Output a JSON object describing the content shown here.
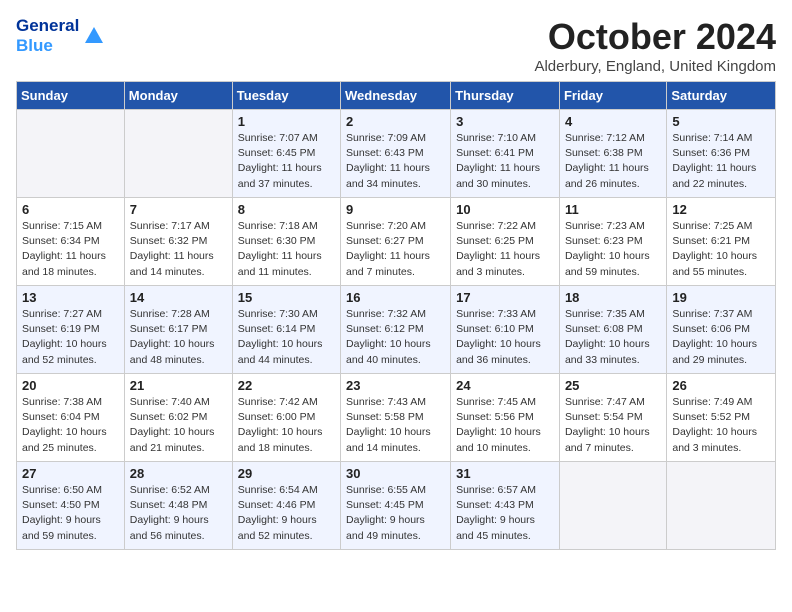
{
  "logo": {
    "line1": "General",
    "line2": "Blue"
  },
  "title": "October 2024",
  "subtitle": "Alderbury, England, United Kingdom",
  "weekdays": [
    "Sunday",
    "Monday",
    "Tuesday",
    "Wednesday",
    "Thursday",
    "Friday",
    "Saturday"
  ],
  "weeks": [
    [
      {
        "day": "",
        "info": ""
      },
      {
        "day": "",
        "info": ""
      },
      {
        "day": "1",
        "info": "Sunrise: 7:07 AM\nSunset: 6:45 PM\nDaylight: 11 hours and 37 minutes."
      },
      {
        "day": "2",
        "info": "Sunrise: 7:09 AM\nSunset: 6:43 PM\nDaylight: 11 hours and 34 minutes."
      },
      {
        "day": "3",
        "info": "Sunrise: 7:10 AM\nSunset: 6:41 PM\nDaylight: 11 hours and 30 minutes."
      },
      {
        "day": "4",
        "info": "Sunrise: 7:12 AM\nSunset: 6:38 PM\nDaylight: 11 hours and 26 minutes."
      },
      {
        "day": "5",
        "info": "Sunrise: 7:14 AM\nSunset: 6:36 PM\nDaylight: 11 hours and 22 minutes."
      }
    ],
    [
      {
        "day": "6",
        "info": "Sunrise: 7:15 AM\nSunset: 6:34 PM\nDaylight: 11 hours and 18 minutes."
      },
      {
        "day": "7",
        "info": "Sunrise: 7:17 AM\nSunset: 6:32 PM\nDaylight: 11 hours and 14 minutes."
      },
      {
        "day": "8",
        "info": "Sunrise: 7:18 AM\nSunset: 6:30 PM\nDaylight: 11 hours and 11 minutes."
      },
      {
        "day": "9",
        "info": "Sunrise: 7:20 AM\nSunset: 6:27 PM\nDaylight: 11 hours and 7 minutes."
      },
      {
        "day": "10",
        "info": "Sunrise: 7:22 AM\nSunset: 6:25 PM\nDaylight: 11 hours and 3 minutes."
      },
      {
        "day": "11",
        "info": "Sunrise: 7:23 AM\nSunset: 6:23 PM\nDaylight: 10 hours and 59 minutes."
      },
      {
        "day": "12",
        "info": "Sunrise: 7:25 AM\nSunset: 6:21 PM\nDaylight: 10 hours and 55 minutes."
      }
    ],
    [
      {
        "day": "13",
        "info": "Sunrise: 7:27 AM\nSunset: 6:19 PM\nDaylight: 10 hours and 52 minutes."
      },
      {
        "day": "14",
        "info": "Sunrise: 7:28 AM\nSunset: 6:17 PM\nDaylight: 10 hours and 48 minutes."
      },
      {
        "day": "15",
        "info": "Sunrise: 7:30 AM\nSunset: 6:14 PM\nDaylight: 10 hours and 44 minutes."
      },
      {
        "day": "16",
        "info": "Sunrise: 7:32 AM\nSunset: 6:12 PM\nDaylight: 10 hours and 40 minutes."
      },
      {
        "day": "17",
        "info": "Sunrise: 7:33 AM\nSunset: 6:10 PM\nDaylight: 10 hours and 36 minutes."
      },
      {
        "day": "18",
        "info": "Sunrise: 7:35 AM\nSunset: 6:08 PM\nDaylight: 10 hours and 33 minutes."
      },
      {
        "day": "19",
        "info": "Sunrise: 7:37 AM\nSunset: 6:06 PM\nDaylight: 10 hours and 29 minutes."
      }
    ],
    [
      {
        "day": "20",
        "info": "Sunrise: 7:38 AM\nSunset: 6:04 PM\nDaylight: 10 hours and 25 minutes."
      },
      {
        "day": "21",
        "info": "Sunrise: 7:40 AM\nSunset: 6:02 PM\nDaylight: 10 hours and 21 minutes."
      },
      {
        "day": "22",
        "info": "Sunrise: 7:42 AM\nSunset: 6:00 PM\nDaylight: 10 hours and 18 minutes."
      },
      {
        "day": "23",
        "info": "Sunrise: 7:43 AM\nSunset: 5:58 PM\nDaylight: 10 hours and 14 minutes."
      },
      {
        "day": "24",
        "info": "Sunrise: 7:45 AM\nSunset: 5:56 PM\nDaylight: 10 hours and 10 minutes."
      },
      {
        "day": "25",
        "info": "Sunrise: 7:47 AM\nSunset: 5:54 PM\nDaylight: 10 hours and 7 minutes."
      },
      {
        "day": "26",
        "info": "Sunrise: 7:49 AM\nSunset: 5:52 PM\nDaylight: 10 hours and 3 minutes."
      }
    ],
    [
      {
        "day": "27",
        "info": "Sunrise: 6:50 AM\nSunset: 4:50 PM\nDaylight: 9 hours and 59 minutes."
      },
      {
        "day": "28",
        "info": "Sunrise: 6:52 AM\nSunset: 4:48 PM\nDaylight: 9 hours and 56 minutes."
      },
      {
        "day": "29",
        "info": "Sunrise: 6:54 AM\nSunset: 4:46 PM\nDaylight: 9 hours and 52 minutes."
      },
      {
        "day": "30",
        "info": "Sunrise: 6:55 AM\nSunset: 4:45 PM\nDaylight: 9 hours and 49 minutes."
      },
      {
        "day": "31",
        "info": "Sunrise: 6:57 AM\nSunset: 4:43 PM\nDaylight: 9 hours and 45 minutes."
      },
      {
        "day": "",
        "info": ""
      },
      {
        "day": "",
        "info": ""
      }
    ]
  ]
}
